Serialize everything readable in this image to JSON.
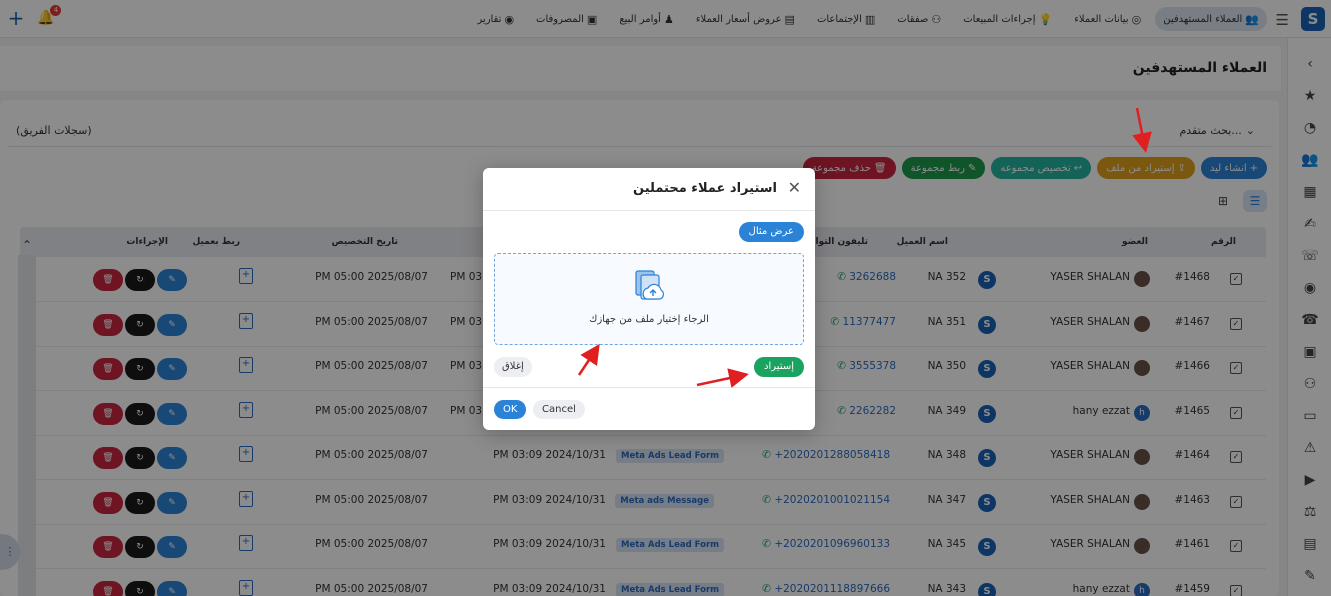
{
  "topnav": {
    "items": [
      {
        "label": "العملاء المستهدفين",
        "icon": "users-icon",
        "active": true
      },
      {
        "label": "بيانات العملاء",
        "icon": "id-badge-icon"
      },
      {
        "label": "إجراءات المبيعات",
        "icon": "lightbulb-icon"
      },
      {
        "label": "صفقات",
        "icon": "people-icon"
      },
      {
        "label": "الإجتماعات",
        "icon": "presentation-icon"
      },
      {
        "label": "عروض أسعار العملاء",
        "icon": "document-icon"
      },
      {
        "label": "أوامر البيع",
        "icon": "person-icon"
      },
      {
        "label": "المصروفات",
        "icon": "portrait-icon"
      },
      {
        "label": "تقارير",
        "icon": "camera-icon"
      }
    ],
    "notification_count": "4"
  },
  "page": {
    "title": "العملاء المستهدفين",
    "advanced_search": "بحث متقدم...",
    "team_records": "(سجلات الفريق)"
  },
  "actions": [
    {
      "label": "انشاء ليد",
      "icon": "+",
      "color": "#2b83d8",
      "name": "create-lead-button"
    },
    {
      "label": "إستيراد من ملف",
      "icon": "⇪",
      "color": "#e0a01c",
      "name": "import-from-file-button"
    },
    {
      "label": "تخصيص مجموعه",
      "icon": "↩",
      "color": "#26b5a0",
      "name": "assign-group-button"
    },
    {
      "label": "ربط مجموعة",
      "icon": "✎",
      "color": "#1e9a4e",
      "name": "link-group-button"
    },
    {
      "label": "حذف مجموعة",
      "icon": "🗑",
      "color": "#c8263e",
      "name": "delete-group-button"
    }
  ],
  "table": {
    "headers": {
      "number": "الرقم",
      "member": "العضو",
      "client_name": "اسم العميل",
      "phone": "تليفون التواصل",
      "assign_date": "تاريخ التخصيص",
      "link_client": "ربط بعميل",
      "actions": "الإجراءات"
    },
    "rows": [
      {
        "id": "#1468",
        "member": "YASER SHALAN",
        "avatar": "photo",
        "client": "NA 352",
        "phone": "3262688",
        "source": "",
        "created": "PM 03",
        "assigned": "PM 05:00 2025/08/07"
      },
      {
        "id": "#1467",
        "member": "YASER SHALAN",
        "avatar": "photo",
        "client": "NA 351",
        "phone": "11377477",
        "source": "",
        "created": "PM 03",
        "assigned": "PM 05:00 2025/08/07"
      },
      {
        "id": "#1466",
        "member": "YASER SHALAN",
        "avatar": "photo",
        "client": "NA 350",
        "phone": "3555378",
        "source": "",
        "created": "PM 03",
        "assigned": "PM 05:00 2025/08/07"
      },
      {
        "id": "#1465",
        "member": "hany ezzat",
        "avatar": "h",
        "client": "NA 349",
        "phone": "2262282",
        "source": "",
        "created": "PM 03",
        "assigned": "PM 05:00 2025/08/07"
      },
      {
        "id": "#1464",
        "member": "YASER SHALAN",
        "avatar": "photo",
        "client": "NA 348",
        "phone": "+202020128805841​8",
        "source": "Meta Ads Lead Form",
        "created": "PM 03:09 2024/10/31",
        "assigned": "PM 05:00 2025/08/07"
      },
      {
        "id": "#1463",
        "member": "YASER SHALAN",
        "avatar": "photo",
        "client": "NA 347",
        "phone": "+2020201001021154",
        "source": "Meta ads Message",
        "created": "PM 03:09 2024/10/31",
        "assigned": "PM 05:00 2025/08/07"
      },
      {
        "id": "#1461",
        "member": "YASER SHALAN",
        "avatar": "photo",
        "client": "NA 345",
        "phone": "+2020201096960133",
        "source": "Meta Ads Lead Form",
        "created": "PM 03:09 2024/10/31",
        "assigned": "PM 05:00 2025/08/07"
      },
      {
        "id": "#1459",
        "member": "hany ezzat",
        "avatar": "h",
        "client": "NA 343",
        "phone": "+2020201118897666",
        "source": "Meta Ads Lead Form",
        "created": "PM 03:09 2024/10/31",
        "assigned": "PM 05:00 2025/08/07"
      }
    ]
  },
  "modal": {
    "title": "استيراد عملاء محتملين",
    "show_example": "عرض مثال",
    "dropzone_text": "الرجاء إختيار ملف من جهازك",
    "import": "إستيراد",
    "close": "إغلاق",
    "ok": "OK",
    "cancel": "Cancel"
  }
}
